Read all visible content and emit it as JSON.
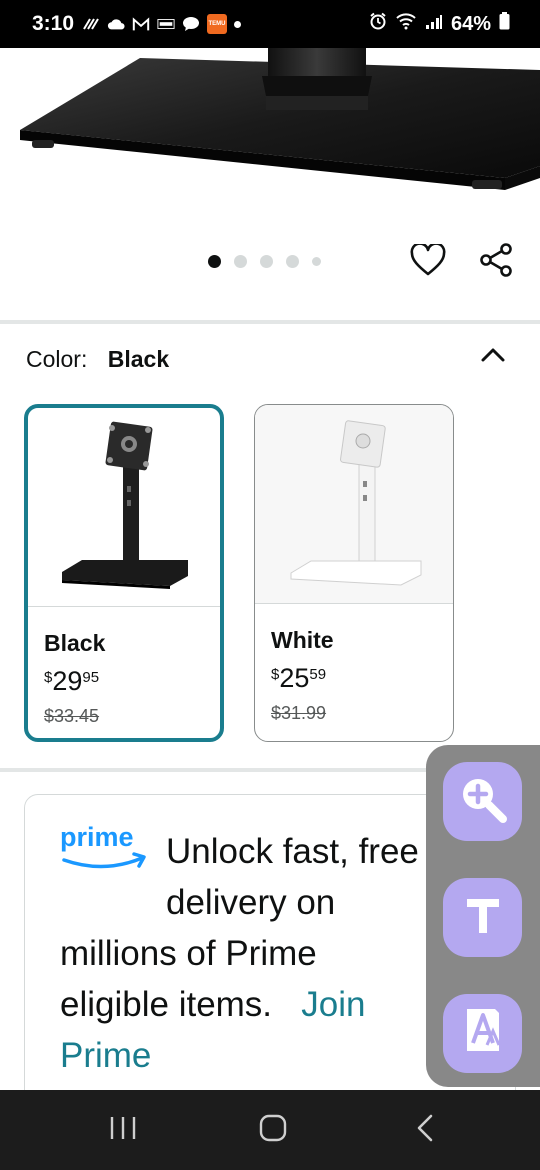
{
  "status_bar": {
    "time": "3:10",
    "battery": "64%",
    "left_icons": [
      "wifi-calling-icon",
      "cloud-icon",
      "gmail-icon",
      "temu-icon",
      "chat-icon",
      "temu-icon",
      "dot-icon"
    ],
    "right_icons": [
      "alarm-icon",
      "wifi-icon",
      "signal-icon",
      "battery-icon"
    ]
  },
  "carousel": {
    "dot_count": 5,
    "active_index": 0
  },
  "color_selector": {
    "label": "Color:",
    "selected": "Black",
    "options": [
      {
        "name": "Black",
        "currency": "$",
        "whole": "29",
        "cents": "95",
        "list_price": "$33.45",
        "selected": true
      },
      {
        "name": "White",
        "currency": "$",
        "whole": "25",
        "cents": "59",
        "list_price": "$31.99",
        "selected": false
      }
    ]
  },
  "prime_banner": {
    "logo_text": "prime",
    "message": "Unlock fast, free delivery on millions of Prime eligible items.",
    "line1": "Unlock fast, free",
    "line2": "delivery on",
    "line3": "millions of Prime",
    "line4": "eligible items.",
    "link_part1": "Join",
    "link_part2": "Prime"
  },
  "accessibility_panel": {
    "buttons": [
      "magnifier-icon",
      "text-size-icon",
      "font-contrast-icon"
    ]
  },
  "colors": {
    "accent": "#1a7d8e",
    "prime_blue": "#1a98ff",
    "panel_button": "#b4a8f0"
  },
  "nav_bar": {
    "buttons": [
      "recents-icon",
      "home-icon",
      "back-icon"
    ]
  }
}
